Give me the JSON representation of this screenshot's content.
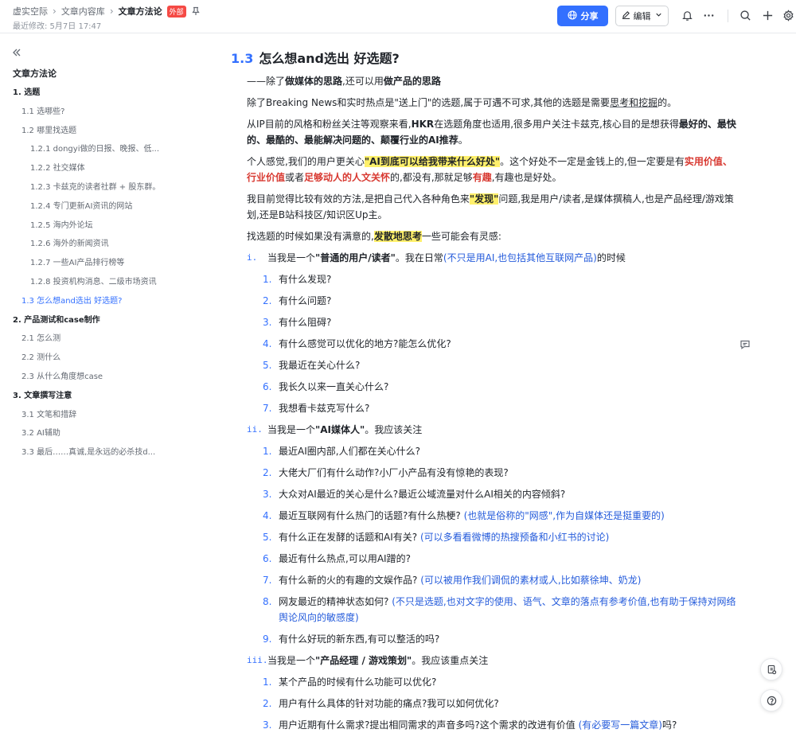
{
  "header": {
    "breadcrumbs": [
      "虚实空际",
      "文章内容库",
      "文章方法论"
    ],
    "badge": "外部",
    "modified": "最近修改: 5月7日 17:47",
    "share_label": "分享",
    "edit_label": "编辑"
  },
  "sidebar": {
    "title": "文章方法论",
    "items": [
      {
        "label": "1. 选题",
        "level": 1
      },
      {
        "label": "1.1 选哪些?",
        "level": 2
      },
      {
        "label": "1.2 哪里找选题",
        "level": 2
      },
      {
        "label": "1.2.1 dongyi做的日报、晚报、低...",
        "level": 3
      },
      {
        "label": "1.2.2 社交媒体",
        "level": 3
      },
      {
        "label": "1.2.3 卡兹克的读者社群 + 股东群。",
        "level": 3
      },
      {
        "label": "1.2.4 专门更新AI资讯的网站",
        "level": 3
      },
      {
        "label": "1.2.5 海内外论坛",
        "level": 3
      },
      {
        "label": "1.2.6 海外的新闻资讯",
        "level": 3
      },
      {
        "label": "1.2.7 一些AI产品排行榜等",
        "level": 3
      },
      {
        "label": "1.2.8 投资机构消息、二级市场资讯",
        "level": 3
      },
      {
        "label": "1.3 怎么想and选出 好选题?",
        "level": 2,
        "active": true
      },
      {
        "label": "2. 产品测试和case制作",
        "level": 1
      },
      {
        "label": "2.1 怎么测",
        "level": 2
      },
      {
        "label": "2.2 测什么",
        "level": 2
      },
      {
        "label": "2.3 从什么角度想case",
        "level": 2
      },
      {
        "label": "3. 文章撰写注意",
        "level": 1
      },
      {
        "label": "3.1 文笔和措辞",
        "level": 2
      },
      {
        "label": "3.2 AI辅助",
        "level": 2
      },
      {
        "label": "3.3 最后……真诚,是永远的必杀技d...",
        "level": 2
      }
    ]
  },
  "content": {
    "heading_num": "1.3",
    "heading_text": "怎么想and选出 好选题?",
    "sub_a": "——除了",
    "sub_b": "做媒体的思路",
    "sub_c": ",还可以用",
    "sub_d": "做产品的思路",
    "p1_a": "除了Breaking News和实时热点是\"送上门\"的选题,属于可遇不可求,其他的选题是需要",
    "p1_b": "思考和挖掘",
    "p1_c": "的。",
    "p2_a": "从IP目前的风格和粉丝关注等观察来看,",
    "p2_b": "HKR",
    "p2_c": "在选题角度也适用,很多用户关注卡兹克,核心目的是想获得",
    "p2_d": "最好的、最快的、最酷的、最能解决问题的、颠覆行业的AI推荐",
    "p2_e": "。",
    "p3_a": "个人感觉,我们的用户更关心",
    "p3_b": "\"AI到底可以给我带来什么好处\"",
    "p3_c": "。这个好处不一定是金钱上的,但一定要是有",
    "p3_d": "实用价值、行业价值",
    "p3_e": "或者",
    "p3_f": "足够动人的人文关怀",
    "p3_g": "的,都没有,那就足够",
    "p3_h": "有趣",
    "p3_i": ",有趣也是好处。",
    "p4_a": "我目前觉得比较有效的方法,是把自己代入各种角色来",
    "p4_b": "\"发现\"",
    "p4_c": "问题,我是用户/读者,是媒体撰稿人,也是产品经理/游戏策划,还是B站科技区/知识区Up主。",
    "p5_a": "找选题的时候如果没有满意的,",
    "p5_b": "发散地思考",
    "p5_c": "一些可能会有灵感:",
    "sections": [
      {
        "rn": "i.",
        "pre": "当我是一个",
        "role": "\"普通的用户/读者\"",
        "post": "。我在日常",
        "note": "(不只是用AI,也包括其他互联网产品)",
        "post2": "的时候",
        "items": [
          {
            "num": "1.",
            "text": "有什么发现?",
            "note": ""
          },
          {
            "num": "2.",
            "text": "有什么问题?",
            "note": ""
          },
          {
            "num": "3.",
            "text": "有什么阻碍?",
            "note": ""
          },
          {
            "num": "4.",
            "text": "有什么感觉可以优化的地方?能怎么优化?",
            "note": ""
          },
          {
            "num": "5.",
            "text": "我最近在关心什么?",
            "note": ""
          },
          {
            "num": "6.",
            "text": "我长久以来一直关心什么?",
            "note": ""
          },
          {
            "num": "7.",
            "text": "我想看卡兹克写什么?",
            "note": ""
          }
        ]
      },
      {
        "rn": "ii.",
        "pre": "当我是一个",
        "role": "\"AI媒体人\"",
        "post": "。我应该关注",
        "note": "",
        "post2": "",
        "items": [
          {
            "num": "1.",
            "text": "最近AI圈内部,人们都在关心什么?",
            "note": ""
          },
          {
            "num": "2.",
            "text": "大佬大厂们有什么动作?小厂小产品有没有惊艳的表现?",
            "note": ""
          },
          {
            "num": "3.",
            "text": "大众对AI最近的关心是什么?最近公域流量对什么AI相关的内容倾斜?",
            "note": ""
          },
          {
            "num": "4.",
            "text": "最近互联网有什么热门的话题?有什么热梗?",
            "note": "(也就是俗称的\"网感\",作为自媒体还是挺重要的)"
          },
          {
            "num": "5.",
            "text": "有什么正在发酵的话题和AI有关?",
            "note": "(可以多看看微博的热搜预备和小红书的讨论)"
          },
          {
            "num": "6.",
            "text": "最近有什么热点,可以用AI蹭的?",
            "note": ""
          },
          {
            "num": "7.",
            "text": "有什么新的火的有趣的文娱作品?",
            "note": "(可以被用作我们调侃的素材或人,比如蔡徐坤、奶龙)"
          },
          {
            "num": "8.",
            "text": "网友最近的精神状态如何?",
            "note": "(不只是选题,也对文字的使用、语气、文章的落点有参考价值,也有助于保持对网络舆论风向的敏感度)"
          },
          {
            "num": "9.",
            "text": "有什么好玩的新东西,有可以整活的吗?",
            "note": ""
          }
        ]
      },
      {
        "rn": "iii.",
        "pre": "当我是一个",
        "role": "\"产品经理 / 游戏策划\"",
        "post": "。我应该重点关注",
        "note": "",
        "post2": "",
        "items": [
          {
            "num": "1.",
            "text": "某个产品的时候有什么功能可以优化?",
            "note": ""
          },
          {
            "num": "2.",
            "text": "用户有什么具体的针对功能的痛点?我可以如何优化?",
            "note": ""
          },
          {
            "num": "3.",
            "text": "用户近期有什么需求?提出相同需求的声音多吗?这个需求的改进有价值",
            "note": "(有必要写一篇文章)",
            "tail": "吗?"
          }
        ]
      }
    ]
  },
  "colors": {
    "accent": "#3370ff",
    "highlight": "#fff06b",
    "red": "#d83931",
    "note": "#245bdb"
  },
  "icons": [
    "pin-icon",
    "globe-icon",
    "pencil-icon",
    "chevron-down-icon",
    "bell-icon",
    "more-icon",
    "search-icon",
    "plus-icon",
    "gear-icon",
    "collapse-icon",
    "comment-icon",
    "doc-icon",
    "help-icon"
  ]
}
